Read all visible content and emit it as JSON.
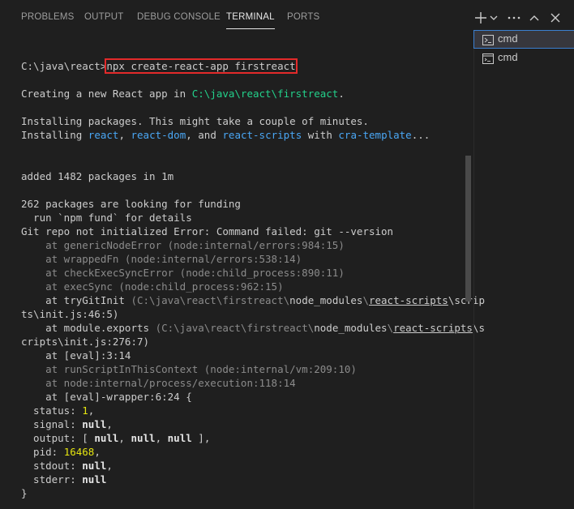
{
  "tabs": [
    {
      "label": "PROBLEMS"
    },
    {
      "label": "OUTPUT"
    },
    {
      "label": "DEBUG CONSOLE"
    },
    {
      "label": "TERMINAL",
      "active": true
    },
    {
      "label": "PORTS"
    }
  ],
  "toolbar_icons": [
    "plus-icon",
    "chevron-down-icon",
    "ellipsis-icon",
    "chevron-up-icon",
    "close-icon"
  ],
  "terminals": [
    {
      "label": "cmd",
      "icon": "terminal-icon",
      "selected": true
    },
    {
      "label": "cmd",
      "icon": "cmd-icon",
      "selected": false
    }
  ],
  "colors": {
    "background": "#1f1f1f",
    "path_green": "#23d18b",
    "package_blue": "#4aa7f5",
    "highlight_box": "#e32a2a",
    "number_yellow": "#e5e510"
  },
  "terminal": {
    "prompt": "C:\\java\\react>",
    "command": "npx create-react-app firstreact",
    "creating_pre": "Creating a new React app in ",
    "creating_path": "C:\\java\\react\\firstreact",
    "creating_post": ".",
    "installing_1": "Installing packages. This might take a couple of minutes.",
    "installing_2_pre": "Installing ",
    "pkg_react": "react",
    "sep1": ", ",
    "pkg_react_dom": "react-dom",
    "sep2": ", and ",
    "pkg_react_scripts": "react-scripts",
    "with": " with ",
    "pkg_cra_template": "cra-template",
    "ellipsis": "...",
    "added": "added 1482 packages in 1m",
    "funding_1": "262 packages are looking for funding",
    "funding_2": "  run `npm fund` for details",
    "git_error": "Git repo not initialized Error: Command failed: git --version",
    "stack_1": "    at genericNodeError (node:internal/errors:984:15)",
    "stack_2": "    at wrappedFn (node:internal/errors:538:14)",
    "stack_3": "    at checkExecSyncError (node:child_process:890:11)",
    "stack_4": "    at execSync (node:child_process:962:15)",
    "stack_5_a": "    at tryGitInit ",
    "stack_5_b": "(C:\\java\\react\\firstreact\\",
    "stack_5_c": "node_modules",
    "stack_5_d": "\\",
    "stack_5_e": "react-scripts",
    "stack_5_f": "\\scrip",
    "stack_5_g": "ts\\init.js:46:5)",
    "stack_6_a": "    at module.exports ",
    "stack_6_b": "(C:\\java\\react\\firstreact\\",
    "stack_6_c": "node_modules",
    "stack_6_d": "\\",
    "stack_6_e": "react-scripts",
    "stack_6_f": "\\s",
    "stack_6_g": "cripts\\init.js:276:7)",
    "stack_7": "    at [eval]:3:14",
    "stack_8": "    at runScriptInThisContext (node:internal/vm:209:10)",
    "stack_9": "    at node:internal/process/execution:118:14",
    "stack_10": "    at [eval]-wrapper:6:24 {",
    "status_key": "  status: ",
    "status_val": "1",
    "status_end": ",",
    "signal_key": "  signal: ",
    "signal_val": "null",
    "signal_end": ",",
    "output_key": "  output: [ ",
    "output_v1": "null",
    "output_s1": ", ",
    "output_v2": "null",
    "output_s2": ", ",
    "output_v3": "null",
    "output_end": " ],",
    "pid_key": "  pid: ",
    "pid_val": "16468",
    "pid_end": ",",
    "stdout_key": "  stdout: ",
    "stdout_val": "null",
    "stdout_end": ",",
    "stderr_key": "  stderr: ",
    "stderr_val": "null",
    "close_brace": "}"
  }
}
